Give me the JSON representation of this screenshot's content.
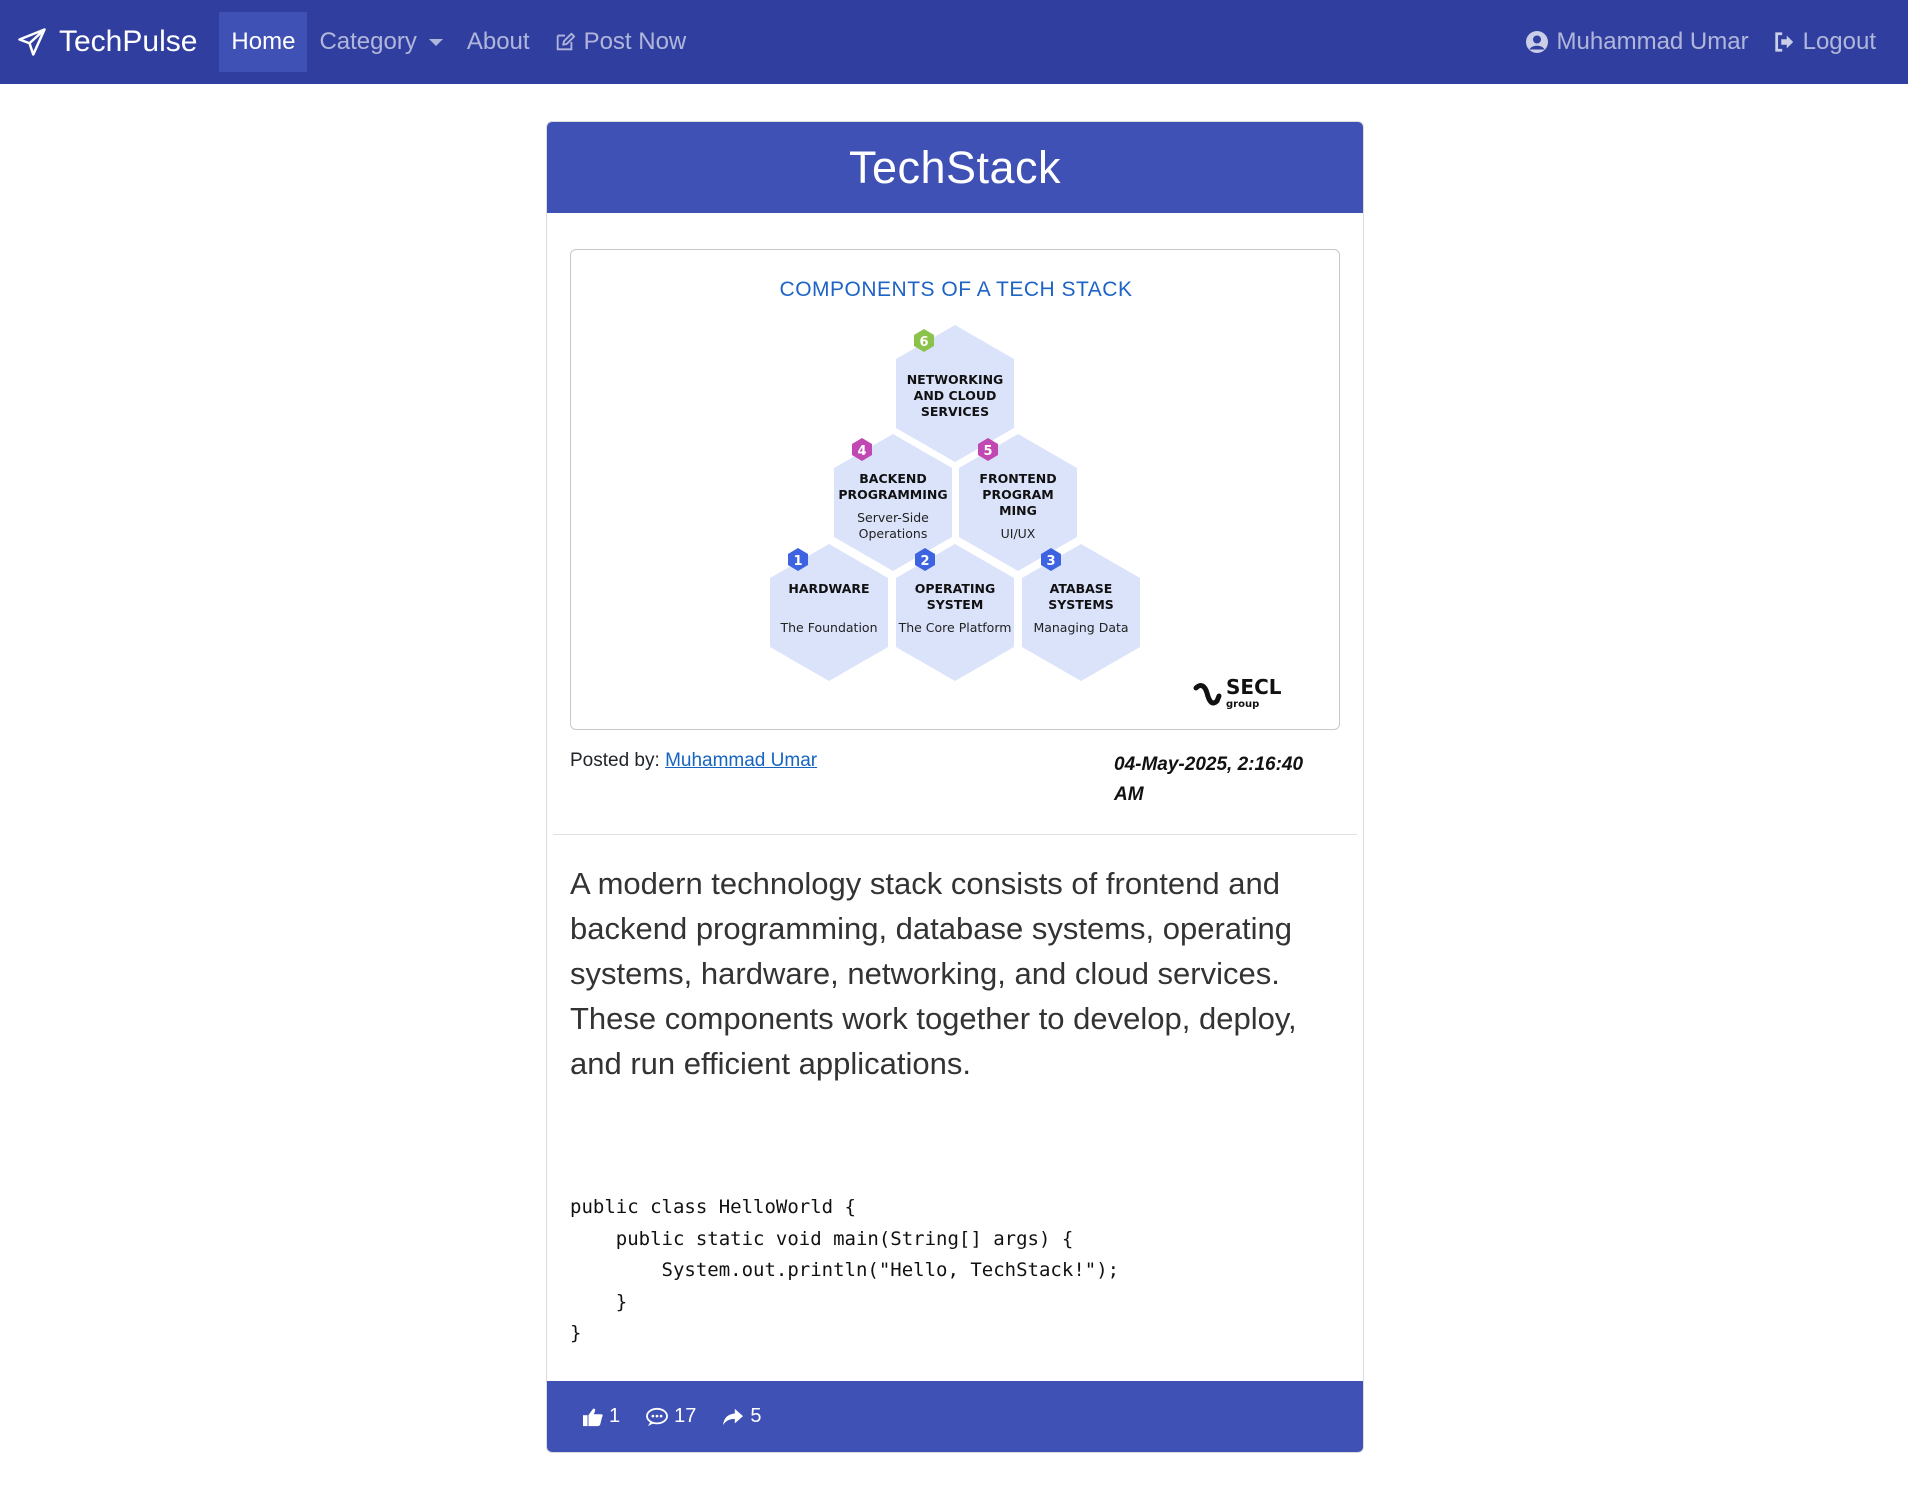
{
  "navbar": {
    "brand": "TechPulse",
    "links": {
      "home": "Home",
      "category": "Category",
      "about": "About",
      "post_now": "Post Now"
    },
    "user": "Muhammad Umar",
    "logout": "Logout"
  },
  "post": {
    "title": "TechStack",
    "image": {
      "heading": "COMPONENTS OF A TECH STACK",
      "hexagons": [
        {
          "num": "6",
          "title": [
            "NETWORKING",
            "AND CLOUD",
            "SERVICES"
          ],
          "subtitle": ""
        },
        {
          "num": "4",
          "title": [
            "BACKEND",
            "PROGRAMMING"
          ],
          "subtitle": [
            "Server-Side",
            "Operations"
          ]
        },
        {
          "num": "5",
          "title": [
            "FRONTEND",
            "PROGRAM",
            "MING"
          ],
          "subtitle": [
            "UI/UX"
          ]
        },
        {
          "num": "1",
          "title": [
            "HARDWARE"
          ],
          "subtitle": [
            "The Foundation"
          ]
        },
        {
          "num": "2",
          "title": [
            "OPERATING",
            "SYSTEM"
          ],
          "subtitle": [
            "The Core Platform"
          ]
        },
        {
          "num": "3",
          "title": [
            "ATABASE",
            "SYSTEMS"
          ],
          "subtitle": [
            "Managing Data"
          ]
        }
      ],
      "logo_text": "SECL",
      "logo_sub": "group"
    },
    "posted_by_label": "Posted by:",
    "author": "Muhammad Umar",
    "date_line1": "04-May-2025, 2:16:40",
    "date_line2": "AM",
    "description": "A modern technology stack consists of frontend and backend programming, database systems, operating systems, hardware, networking, and cloud services. These components work together to develop, deploy, and run efficient applications.",
    "code": "public class HelloWorld {\n    public static void main(String[] args) {\n        System.out.println(\"Hello, TechStack!\");\n    }\n}",
    "likes": "1",
    "comments": "17",
    "shares": "5"
  },
  "colors": {
    "navbar": "#303f9f",
    "accent": "#3f51b5",
    "link": "#1565c0",
    "hex_fill": "#dbe3fb",
    "badge_green": "#8bc34a",
    "badge_magenta": "#c147b3",
    "badge_blue": "#3d63e0"
  }
}
